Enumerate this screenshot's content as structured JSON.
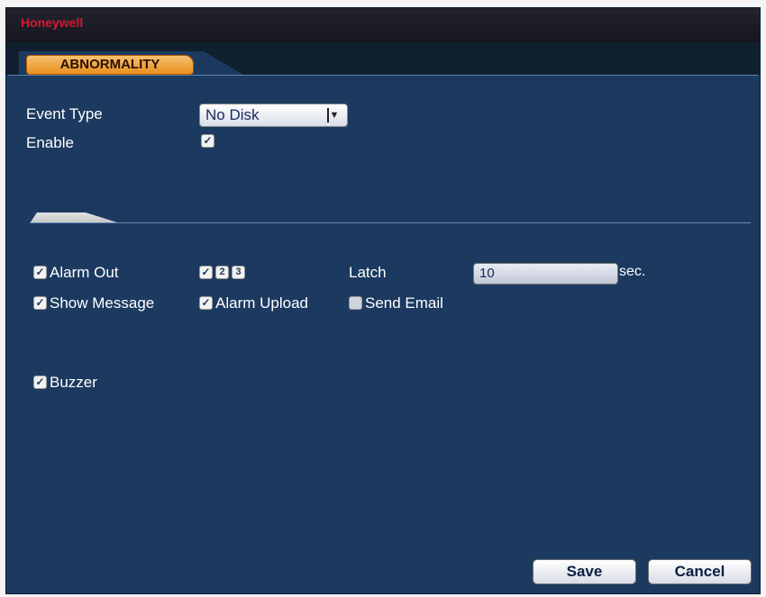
{
  "window": {
    "brand": "Honeywell"
  },
  "tabs": [
    {
      "label": "ABNORMALITY",
      "active": true
    }
  ],
  "form": {
    "event_type_label": "Event Type",
    "event_type_value": "No Disk",
    "enable_label": "Enable",
    "enable_checked": true
  },
  "actions": {
    "alarm_out_label": "Alarm Out",
    "alarm_out_checked": true,
    "alarm_channels": [
      {
        "number": "1",
        "checked": true
      },
      {
        "number": "2",
        "checked": false
      },
      {
        "number": "3",
        "checked": false
      }
    ],
    "latch_label": "Latch",
    "latch_value": "10",
    "latch_unit": "sec.",
    "show_message_label": "Show Message",
    "show_message_checked": true,
    "alarm_upload_label": "Alarm Upload",
    "alarm_upload_checked": true,
    "send_email_label": "Send Email",
    "send_email_checked": false,
    "buzzer_label": "Buzzer",
    "buzzer_checked": true
  },
  "buttons": {
    "save": "Save",
    "cancel": "Cancel"
  },
  "icons": {
    "checkbox_checked": "check-icon",
    "dropdown": "dropdown-arrow-icon"
  },
  "colors": {
    "panel_bg": "#1c3a60",
    "tab_accent": "#e8901e",
    "brand": "#d4192f"
  }
}
